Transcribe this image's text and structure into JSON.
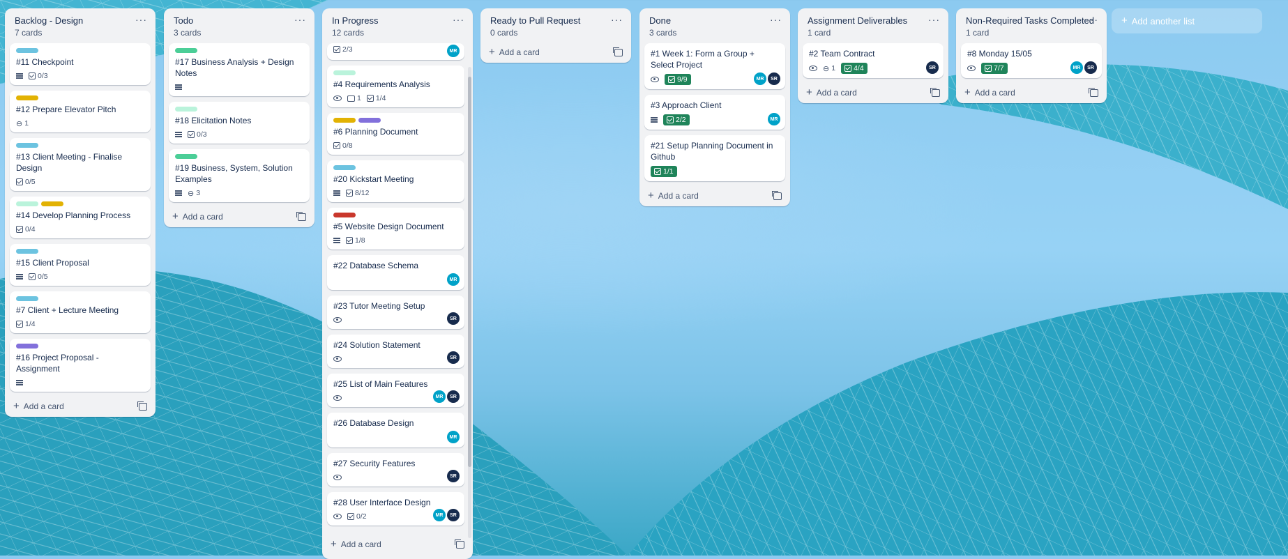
{
  "colors": {
    "label_teal": "#6cc3e0",
    "label_green": "#4bce97",
    "label_lightgreen": "#baf3db",
    "label_yellow": "#e2b203",
    "label_purple": "#8270db",
    "label_red": "#c9372c",
    "badge_complete": "#1f845a",
    "avatar_mr": "#00a2c8",
    "avatar_sr": "#172b4d"
  },
  "board": {
    "add_card_label": "Add a card",
    "add_list_label": "Add another list",
    "menu_glyph": "···",
    "lists": [
      {
        "title": "Backlog - Design",
        "count": "7 cards",
        "cards": [
          {
            "title": "#11 Checkpoint",
            "labels": [
              "teal"
            ],
            "desc": true,
            "checklist": "0/3"
          },
          {
            "title": "#12 Prepare Elevator Pitch",
            "labels": [
              "yellow"
            ],
            "attachments": "1"
          },
          {
            "title": "#13 Client Meeting - Finalise Design",
            "labels": [
              "teal"
            ],
            "checklist": "0/5"
          },
          {
            "title": "#14 Develop Planning Process",
            "labels": [
              "lightgreen",
              "yellow"
            ],
            "checklist": "0/4"
          },
          {
            "title": "#15 Client Proposal",
            "labels": [
              "teal"
            ],
            "desc": true,
            "checklist": "0/5"
          },
          {
            "title": "#7 Client + Lecture Meeting",
            "labels": [
              "teal"
            ],
            "checklist": "1/4"
          },
          {
            "title": "#16 Project Proposal - Assignment",
            "labels": [
              "purple"
            ],
            "desc": true
          }
        ]
      },
      {
        "title": "Todo",
        "count": "3 cards",
        "cards": [
          {
            "title": "#17 Business Analysis + Design Notes",
            "labels": [
              "green"
            ],
            "desc": true
          },
          {
            "title": "#18 Elicitation Notes",
            "labels": [
              "lightgreen"
            ],
            "desc": true,
            "checklist": "0/3"
          },
          {
            "title": "#19 Business, System, Solution Examples",
            "labels": [
              "green"
            ],
            "desc": true,
            "attachments": "3"
          }
        ]
      },
      {
        "title": "In Progress",
        "count": "12 cards",
        "cards": [
          {
            "title": "",
            "checklist": "2/3",
            "members": [
              "MR"
            ],
            "partial": true
          },
          {
            "title": "#4 Requirements Analysis",
            "labels": [
              "lightgreen"
            ],
            "watch": true,
            "comments": "1",
            "checklist": "1/4"
          },
          {
            "title": "#6 Planning Document",
            "labels": [
              "yellow",
              "purple"
            ],
            "checklist": "0/8"
          },
          {
            "title": "#20 Kickstart Meeting",
            "labels": [
              "teal"
            ],
            "desc": true,
            "checklist": "8/12"
          },
          {
            "title": "#5 Website Design Document",
            "labels": [
              "red"
            ],
            "desc": true,
            "checklist": "1/8"
          },
          {
            "title": "#22 Database Schema",
            "members": [
              "MR"
            ]
          },
          {
            "title": "#23 Tutor Meeting Setup",
            "watch": true,
            "members": [
              "SR"
            ]
          },
          {
            "title": "#24 Solution Statement",
            "watch": true,
            "members": [
              "SR"
            ]
          },
          {
            "title": "#25 List of Main Features",
            "watch": true,
            "members": [
              "MR",
              "SR"
            ]
          },
          {
            "title": "#26 Database Design",
            "members": [
              "MR"
            ]
          },
          {
            "title": "#27 Security Features",
            "watch": true,
            "members": [
              "SR"
            ]
          },
          {
            "title": "#28 User Interface Design",
            "watch": true,
            "checklist": "0/2",
            "members": [
              "MR",
              "SR"
            ]
          }
        ]
      },
      {
        "title": "Ready to Pull Request",
        "count": "0 cards",
        "cards": []
      },
      {
        "title": "Done",
        "count": "3 cards",
        "cards": [
          {
            "title": "#1 Week 1: Form a Group + Select Project",
            "watch": true,
            "checklist_done": "9/9",
            "members": [
              "MR",
              "SR"
            ]
          },
          {
            "title": "#3 Approach Client",
            "desc": true,
            "checklist_done": "2/2",
            "members": [
              "MR"
            ]
          },
          {
            "title": "#21 Setup Planning Document in Github",
            "checklist_done": "1/1"
          }
        ]
      },
      {
        "title": "Assignment Deliverables",
        "count": "1 card",
        "cards": [
          {
            "title": "#2 Team Contract",
            "watch": true,
            "attachments": "1",
            "checklist_done": "4/4",
            "members": [
              "SR"
            ]
          }
        ]
      },
      {
        "title": "Non-Required Tasks Completed",
        "count": "1 card",
        "cards": [
          {
            "title": "#8 Monday 15/05",
            "watch": true,
            "checklist_done": "7/7",
            "members": [
              "MR",
              "SR"
            ]
          }
        ]
      }
    ]
  }
}
